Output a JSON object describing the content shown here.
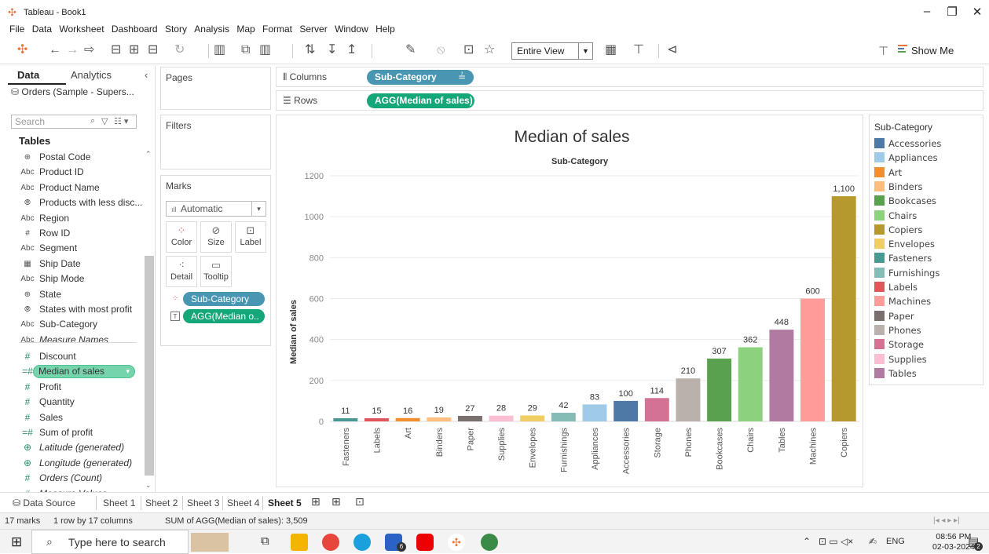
{
  "window": {
    "title": "Tableau - Book1"
  },
  "menu": [
    "File",
    "Data",
    "Worksheet",
    "Dashboard",
    "Story",
    "Analysis",
    "Map",
    "Format",
    "Server",
    "Window",
    "Help"
  ],
  "toolbar": {
    "view_select": "Entire View",
    "show_me": "Show Me"
  },
  "datapane": {
    "tab_data": "Data",
    "tab_analytics": "Analytics",
    "datasource": "Orders (Sample - Supers...",
    "search_placeholder": "Search",
    "tables_heading": "Tables",
    "fields": [
      {
        "type": "geo",
        "icon": "⊕",
        "name": "Postal Code"
      },
      {
        "type": "dim",
        "icon": "Abc",
        "name": "Product ID"
      },
      {
        "type": "dim",
        "icon": "Abc",
        "name": "Product Name"
      },
      {
        "type": "set",
        "icon": "⦾",
        "name": "Products with less disc..."
      },
      {
        "type": "dim",
        "icon": "Abc",
        "name": "Region"
      },
      {
        "type": "num",
        "icon": "#",
        "name": "Row ID"
      },
      {
        "type": "dim",
        "icon": "Abc",
        "name": "Segment"
      },
      {
        "type": "date",
        "icon": "▦",
        "name": "Ship Date"
      },
      {
        "type": "dim",
        "icon": "Abc",
        "name": "Ship Mode"
      },
      {
        "type": "geo",
        "icon": "⊕",
        "name": "State"
      },
      {
        "type": "set",
        "icon": "⦾",
        "name": "States with most profit"
      },
      {
        "type": "dim",
        "icon": "Abc",
        "name": "Sub-Category"
      },
      {
        "type": "dim",
        "icon": "Abc",
        "name": "Measure Names",
        "italic": true
      },
      {
        "type": "measure",
        "icon": "#",
        "name": "Discount"
      },
      {
        "type": "measure",
        "icon": "=#",
        "name": "Median of sales",
        "pill": true
      },
      {
        "type": "measure",
        "icon": "#",
        "name": "Profit"
      },
      {
        "type": "measure",
        "icon": "#",
        "name": "Quantity"
      },
      {
        "type": "measure",
        "icon": "#",
        "name": "Sales"
      },
      {
        "type": "measure",
        "icon": "=#",
        "name": "Sum of profit"
      },
      {
        "type": "measure",
        "icon": "⊕",
        "name": "Latitude (generated)",
        "italic": true
      },
      {
        "type": "measure",
        "icon": "⊕",
        "name": "Longitude (generated)",
        "italic": true
      },
      {
        "type": "measure",
        "icon": "#",
        "name": "Orders (Count)",
        "italic": true
      },
      {
        "type": "measure",
        "icon": "#",
        "name": "Measure Values",
        "italic": true
      }
    ]
  },
  "cards": {
    "pages": "Pages",
    "filters": "Filters",
    "marks": "Marks",
    "marks_type": "Automatic",
    "buttons": {
      "color": "Color",
      "size": "Size",
      "label": "Label",
      "detail": "Detail",
      "tooltip": "Tooltip"
    },
    "mark_pills": {
      "color_pill": "Sub-Category",
      "label_pill": "AGG(Median o.."
    }
  },
  "shelves": {
    "columns_label": "Columns",
    "columns_pill": "Sub-Category",
    "rows_label": "Rows",
    "rows_pill": "AGG(Median of sales)"
  },
  "chart_data": {
    "type": "bar",
    "title": "Median of sales",
    "xlabel": "Sub-Category",
    "ylabel": "Median of sales",
    "ylim": [
      0,
      1200
    ],
    "yticks": [
      0,
      200,
      400,
      600,
      800,
      1000,
      1200
    ],
    "grid": true,
    "categories": [
      "Fasteners",
      "Labels",
      "Art",
      "Binders",
      "Paper",
      "Supplies",
      "Envelopes",
      "Furnishings",
      "Appliances",
      "Accessories",
      "Storage",
      "Phones",
      "Bookcases",
      "Chairs",
      "Tables",
      "Machines",
      "Copiers"
    ],
    "values": [
      11,
      15,
      16,
      19,
      27,
      28,
      29,
      42,
      83,
      100,
      114,
      210,
      307,
      362,
      448,
      600,
      1100
    ],
    "labels": [
      "11",
      "15",
      "16",
      "19",
      "27",
      "28",
      "29",
      "42",
      "83",
      "100",
      "114",
      "210",
      "307",
      "362",
      "448",
      "600",
      "1,100"
    ],
    "colors": [
      "#499894",
      "#e15759",
      "#f28e2b",
      "#ffbe7d",
      "#79706e",
      "#fabfd2",
      "#f1ce63",
      "#86bcb6",
      "#a0cbe8",
      "#4e79a7",
      "#d37295",
      "#bab0ac",
      "#59a14f",
      "#8cd17d",
      "#b07aa1",
      "#ff9d9a",
      "#b6992d"
    ],
    "legend": {
      "title": "Sub-Category",
      "placement": "right",
      "items": [
        {
          "name": "Accessories",
          "color": "#4e79a7"
        },
        {
          "name": "Appliances",
          "color": "#a0cbe8"
        },
        {
          "name": "Art",
          "color": "#f28e2b"
        },
        {
          "name": "Binders",
          "color": "#ffbe7d"
        },
        {
          "name": "Bookcases",
          "color": "#59a14f"
        },
        {
          "name": "Chairs",
          "color": "#8cd17d"
        },
        {
          "name": "Copiers",
          "color": "#b6992d"
        },
        {
          "name": "Envelopes",
          "color": "#f1ce63"
        },
        {
          "name": "Fasteners",
          "color": "#499894"
        },
        {
          "name": "Furnishings",
          "color": "#86bcb6"
        },
        {
          "name": "Labels",
          "color": "#e15759"
        },
        {
          "name": "Machines",
          "color": "#ff9d9a"
        },
        {
          "name": "Paper",
          "color": "#79706e"
        },
        {
          "name": "Phones",
          "color": "#bab0ac"
        },
        {
          "name": "Storage",
          "color": "#d37295"
        },
        {
          "name": "Supplies",
          "color": "#fabfd2"
        },
        {
          "name": "Tables",
          "color": "#b07aa1"
        }
      ]
    }
  },
  "sheets": {
    "data_source": "Data Source",
    "tabs": [
      "Sheet 1",
      "Sheet 2",
      "Sheet 3",
      "Sheet 4",
      "Sheet 5"
    ],
    "active": "Sheet 5"
  },
  "status": {
    "marks": "17 marks",
    "dims": "1 row by 17 columns",
    "sum": "SUM of AGG(Median of sales): 3,509"
  },
  "taskbar": {
    "search_placeholder": "Type here to search",
    "lang": "ENG",
    "time": "08:56 PM",
    "date": "02-03-2024",
    "mail_badge": "6",
    "notif_badge": "2"
  },
  "colors": {
    "dimension_pill": "#4996b2",
    "measure_pill": "#15a77a",
    "measure_field_pill": "#76d4ad"
  }
}
